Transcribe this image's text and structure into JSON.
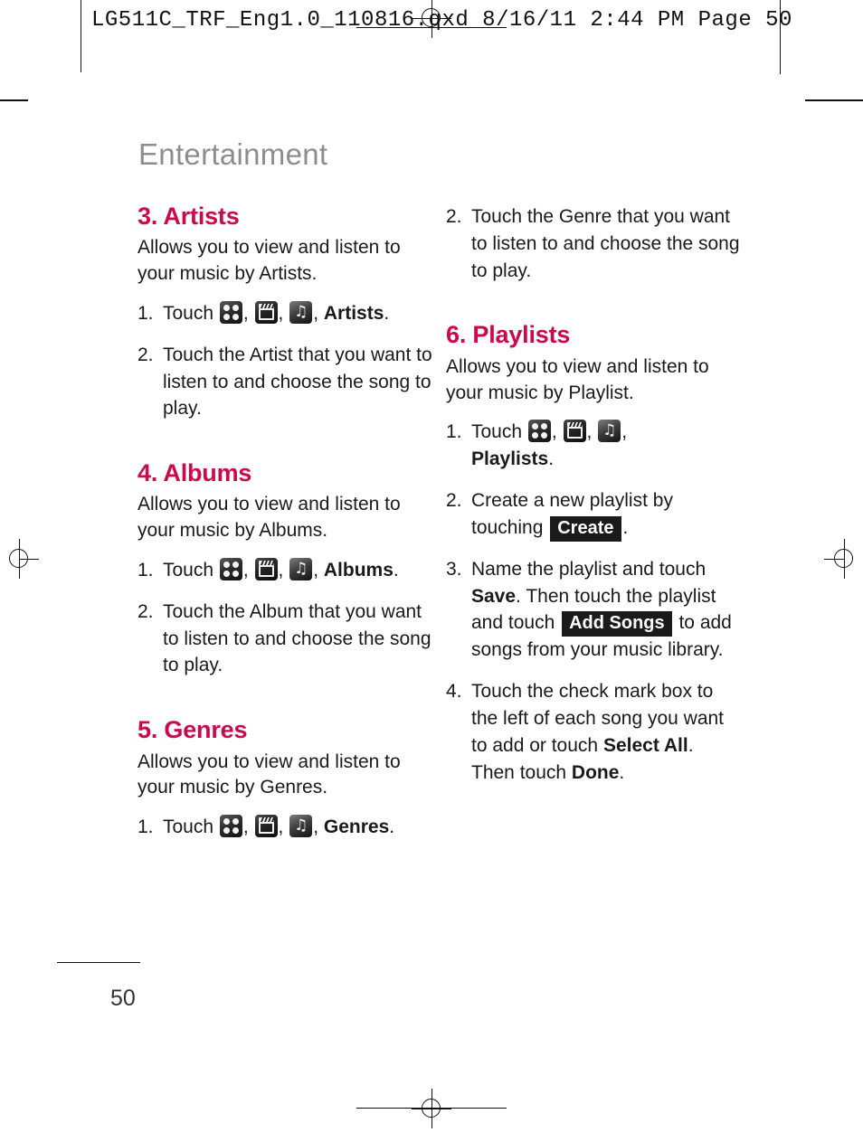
{
  "prepress": {
    "slug": "LG511C_TRF_Eng1.0_110816.qxd   8/16/11   2:44 PM   Page 50"
  },
  "page": {
    "title": "Entertainment",
    "number": "50",
    "heading_color": "#cc0a4b",
    "title_color": "#8d8d8d"
  },
  "icons": {
    "menu": "apps-grid-icon",
    "media": "media-clapperboard-icon",
    "music": "music-note-icon",
    "note_glyph": "♫"
  },
  "left_column": {
    "sections": [
      {
        "heading": "3. Artists",
        "lead": "Allows you to view and listen to your music by Artists.",
        "steps": [
          {
            "num": "1.",
            "pre": "Touch ",
            "has_icons": true,
            "sep1": ", ",
            "sep2": ", ",
            "sep3": ", ",
            "bold_tail": "Artists",
            "post": "."
          },
          {
            "num": "2.",
            "text": "Touch the Artist that you want to listen to and choose the song to play."
          }
        ]
      },
      {
        "heading": "4. Albums",
        "lead": "Allows you to view and listen to your music by Albums.",
        "steps": [
          {
            "num": "1.",
            "pre": "Touch ",
            "has_icons": true,
            "sep1": ", ",
            "sep2": ", ",
            "sep3": ", ",
            "bold_tail": "Albums",
            "post": "."
          },
          {
            "num": "2.",
            "text": "Touch the Album that you want to listen to and choose the song to play."
          }
        ]
      },
      {
        "heading": "5. Genres",
        "lead": "Allows you to view and listen to your music by Genres.",
        "steps": [
          {
            "num": "1.",
            "pre": "Touch ",
            "has_icons": true,
            "sep1": ", ",
            "sep2": ", ",
            "sep3": ", ",
            "bold_tail": "Genres",
            "post": "."
          }
        ]
      }
    ]
  },
  "right_column": {
    "genres_step2": {
      "num": "2.",
      "text": "Touch the Genre that you want to listen to and choose the song to play."
    },
    "playlists": {
      "heading": "6. Playlists",
      "lead": "Allows you to view and listen to your music by Playlist.",
      "step1": {
        "num": "1.",
        "pre": "Touch ",
        "sep1": ", ",
        "sep2": ", ",
        "sep3": ",",
        "bold_tail": "Playlists",
        "post": "."
      },
      "step2": {
        "num": "2.",
        "pre": "Create a new playlist by touching ",
        "key": "Create",
        "post": "."
      },
      "step3": {
        "num": "3.",
        "pre": "Name the playlist and touch ",
        "bold1": "Save",
        "mid": ". Then touch the playlist and touch ",
        "key": "Add Songs",
        "post": " to add songs from your music library."
      },
      "step4": {
        "num": "4.",
        "pre": "Touch the check mark box to the left of each song you want to add or touch ",
        "bold1": "Select All",
        "mid": ". Then touch ",
        "bold2": "Done",
        "post": "."
      }
    }
  }
}
